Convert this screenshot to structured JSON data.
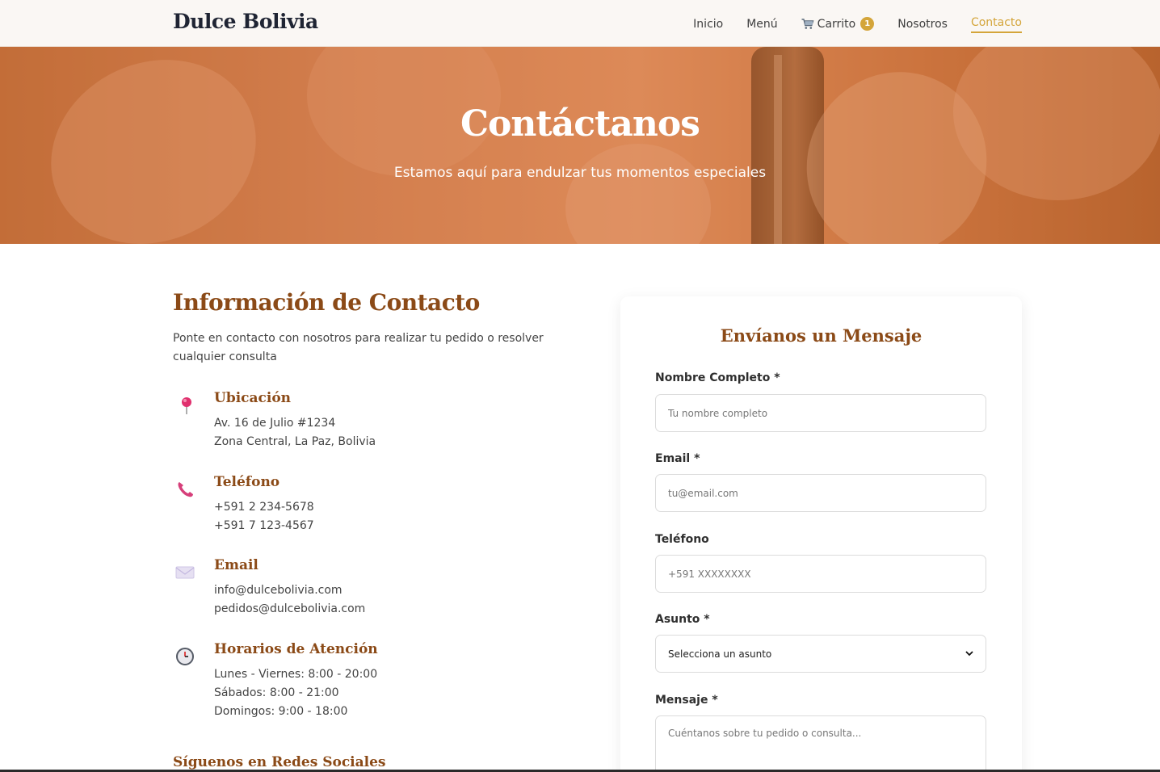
{
  "nav": {
    "brand": "Dulce Bolivia",
    "links": [
      {
        "label": "Inicio"
      },
      {
        "label": "Menú"
      },
      {
        "label": "Carrito",
        "icon": "cart-icon",
        "badge": "1"
      },
      {
        "label": "Nosotros"
      },
      {
        "label": "Contacto",
        "active": true
      }
    ]
  },
  "hero": {
    "title": "Contáctanos",
    "subtitle": "Estamos aquí para endulzar tus momentos especiales"
  },
  "info": {
    "title": "Información de Contacto",
    "description": "Ponte en contacto con nosotros para realizar tu pedido o resolver cualquier consulta",
    "items": [
      {
        "icon": "pushpin-icon",
        "title": "Ubicación",
        "lines": [
          "Av. 16 de Julio #1234",
          "Zona Central, La Paz, Bolivia"
        ]
      },
      {
        "icon": "phone-icon",
        "title": "Teléfono",
        "lines": [
          "+591 2 234-5678",
          "+591 7 123-4567"
        ]
      },
      {
        "icon": "envelope-icon",
        "title": "Email",
        "lines": [
          "info@dulcebolivia.com",
          "pedidos@dulcebolivia.com"
        ]
      },
      {
        "icon": "clock-icon",
        "title": "Horarios de Atención",
        "lines": [
          "Lunes - Viernes: 8:00 - 20:00",
          "Sábados: 8:00 - 21:00",
          "Domingos: 9:00 - 18:00"
        ]
      }
    ],
    "social_title": "Síguenos en Redes Sociales"
  },
  "form": {
    "title": "Envíanos un Mensaje",
    "name_label": "Nombre Completo *",
    "name_placeholder": "Tu nombre completo",
    "email_label": "Email *",
    "email_placeholder": "tu@email.com",
    "phone_label": "Teléfono",
    "phone_placeholder": "+591 XXXXXXXX",
    "subject_label": "Asunto *",
    "subject_selected": "Selecciona un asunto",
    "message_label": "Mensaje *",
    "message_placeholder": "Cuéntanos sobre tu pedido o consulta..."
  },
  "colors": {
    "accent": "#d4a53a",
    "brown": "#8b4a17",
    "hero": "#d9885a"
  }
}
